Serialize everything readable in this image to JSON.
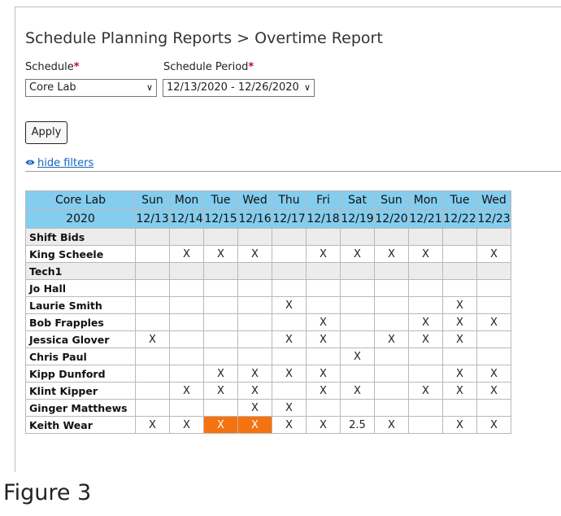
{
  "page": {
    "title": "Schedule Planning Reports > Overtime Report",
    "caption": "Figure 3"
  },
  "filters": {
    "schedule_label": "Schedule",
    "schedule_value": "Core Lab",
    "period_label": "Schedule Period",
    "period_value": "12/13/2020 - 12/26/2020",
    "required_mark": "*",
    "apply_label": "Apply",
    "hide_filters_label": "hide filters"
  },
  "icons": {
    "dropdown": "chevron-down-icon",
    "toggle": "eye-icon"
  },
  "colors": {
    "header_bg": "#84cdee",
    "group_bg": "#ececec",
    "highlight": "#f5730f",
    "link": "#1565c0",
    "required": "#d0021b"
  },
  "table": {
    "corner_top": "Core Lab",
    "corner_bottom": "2020",
    "days": [
      "Sun",
      "Mon",
      "Tue",
      "Wed",
      "Thu",
      "Fri",
      "Sat",
      "Sun",
      "Mon",
      "Tue",
      "Wed"
    ],
    "dates": [
      "12/13",
      "12/14",
      "12/15",
      "12/16",
      "12/17",
      "12/18",
      "12/19",
      "12/20",
      "12/21",
      "12/22",
      "12/23"
    ],
    "rows": [
      {
        "name": "Shift Bids",
        "group": true,
        "cells": [
          "",
          "",
          "",
          "",
          "",
          "",
          "",
          "",
          "",
          "",
          ""
        ]
      },
      {
        "name": "King Scheele",
        "group": false,
        "cells": [
          "",
          "X",
          "X",
          "X",
          "",
          "X",
          "X",
          "X",
          "X",
          "",
          "X"
        ]
      },
      {
        "name": "Tech1",
        "group": true,
        "cells": [
          "",
          "",
          "",
          "",
          "",
          "",
          "",
          "",
          "",
          "",
          ""
        ]
      },
      {
        "name": "Jo Hall",
        "group": false,
        "cells": [
          "",
          "",
          "",
          "",
          "",
          "",
          "",
          "",
          "",
          "",
          ""
        ]
      },
      {
        "name": "Laurie Smith",
        "group": false,
        "cells": [
          "",
          "",
          "",
          "",
          "X",
          "",
          "",
          "",
          "",
          "X",
          ""
        ]
      },
      {
        "name": "Bob Frapples",
        "group": false,
        "cells": [
          "",
          "",
          "",
          "",
          "",
          "X",
          "",
          "",
          "X",
          "X",
          "X"
        ]
      },
      {
        "name": "Jessica Glover",
        "group": false,
        "cells": [
          "X",
          "",
          "",
          "",
          "X",
          "X",
          "",
          "X",
          "X",
          "X",
          ""
        ]
      },
      {
        "name": "Chris Paul",
        "group": false,
        "cells": [
          "",
          "",
          "",
          "",
          "",
          "",
          "X",
          "",
          "",
          "",
          ""
        ]
      },
      {
        "name": "Kipp Dunford",
        "group": false,
        "cells": [
          "",
          "",
          "X",
          "X",
          "X",
          "X",
          "",
          "",
          "",
          "X",
          "X"
        ]
      },
      {
        "name": "Klint Kipper",
        "group": false,
        "cells": [
          "",
          "X",
          "X",
          "X",
          "",
          "X",
          "X",
          "",
          "X",
          "X",
          "X"
        ]
      },
      {
        "name": "Ginger Matthews",
        "group": false,
        "cells": [
          "",
          "",
          "",
          "X",
          "X",
          "",
          "",
          "",
          "",
          "",
          ""
        ]
      },
      {
        "name": "Keith Wear",
        "group": false,
        "cells": [
          "X",
          "X",
          "X",
          "X",
          "X",
          "X",
          "2.5",
          "X",
          "",
          "X",
          "X"
        ],
        "highlight": [
          2,
          3
        ]
      }
    ]
  }
}
